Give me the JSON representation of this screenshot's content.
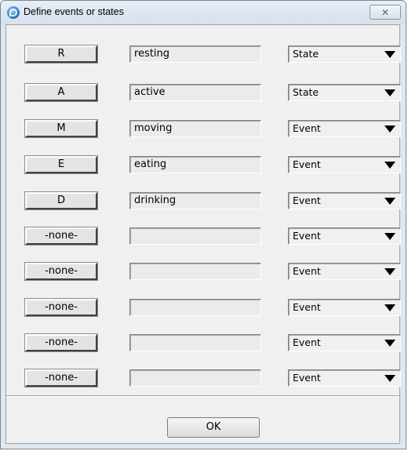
{
  "window": {
    "title": "Define events or states",
    "close_label": "✕"
  },
  "rows": [
    {
      "code": "R",
      "label": "resting",
      "type": "State"
    },
    {
      "code": "A",
      "label": "active",
      "type": "State"
    },
    {
      "code": "M",
      "label": "moving",
      "type": "Event"
    },
    {
      "code": "E",
      "label": "eating",
      "type": "Event"
    },
    {
      "code": "D",
      "label": "drinking",
      "type": "Event"
    },
    {
      "code": "-none-",
      "label": "",
      "type": "Event"
    },
    {
      "code": "-none-",
      "label": "",
      "type": "Event"
    },
    {
      "code": "-none-",
      "label": "",
      "type": "Event"
    },
    {
      "code": "-none-",
      "label": "",
      "type": "Event"
    },
    {
      "code": "-none-",
      "label": "",
      "type": "Event"
    }
  ],
  "footer": {
    "ok_label": "OK"
  }
}
